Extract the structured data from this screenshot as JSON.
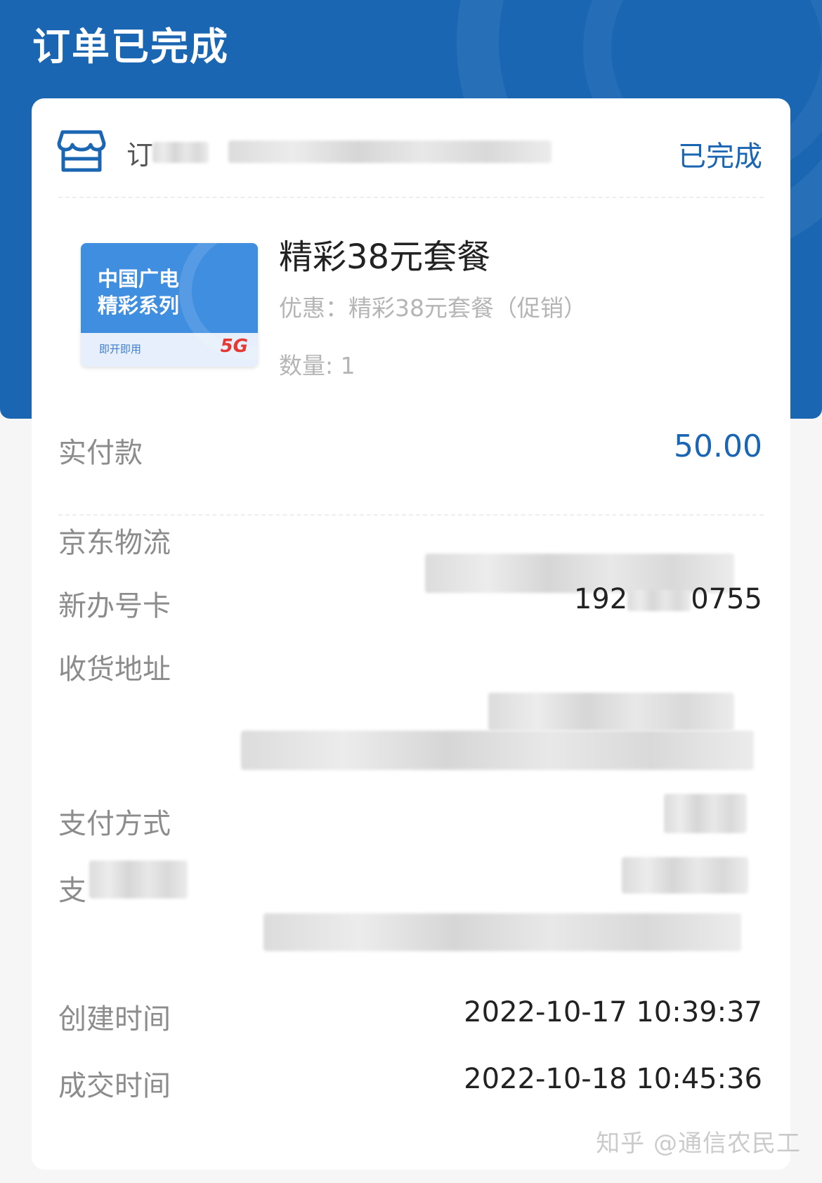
{
  "header": {
    "title": "订单已完成"
  },
  "order": {
    "label": "订",
    "status": "已完成",
    "icon": "shop-icon"
  },
  "product": {
    "image_line1": "中国广电",
    "image_line2": "精彩系列",
    "image_tag": "即开即用",
    "image_badge": "5G",
    "name": "精彩38元套餐",
    "promo": "优惠：精彩38元套餐（促销）",
    "quantity": "数量: 1"
  },
  "details": {
    "paid_label": "实付款",
    "paid_value": "50.00",
    "logistics_label": "京东物流",
    "new_card_label": "新办号卡",
    "new_card_prefix": "192",
    "new_card_suffix": "0755",
    "address_label": "收货地址",
    "payment_method_label": "支付方式",
    "payment_id_label": "支",
    "created_label": "创建时间",
    "created_value": "2022-10-17 10:39:37",
    "deal_label": "成交时间",
    "deal_value": "2022-10-18 10:45:36"
  },
  "watermark": "知乎 @通信农民工",
  "colors": {
    "brand_blue": "#1a66b3",
    "label_gray": "#8c8c8c",
    "page_bg": "#f6f6f6"
  }
}
